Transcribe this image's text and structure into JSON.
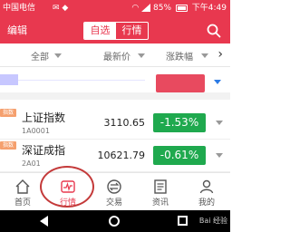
{
  "status_bar": {
    "carrier": "中国电信",
    "battery_percent": "85%",
    "time": "下午4:49"
  },
  "header": {
    "edit_label": "编辑",
    "tabs": [
      {
        "label": "自选",
        "active": true
      },
      {
        "label": "行情",
        "active": false
      }
    ],
    "search_icon": "search-icon"
  },
  "columns": {
    "all": "全部",
    "price": "最新价",
    "change": "涨跌幅"
  },
  "rows": [
    {
      "tag": "指数",
      "name": "上证指数",
      "code": "1A0001",
      "price": "3110.65",
      "change": "-1.53%"
    },
    {
      "tag": "指数",
      "name": "深证成指",
      "code": "2A01",
      "price": "10621.79",
      "change": "-0.61%"
    }
  ],
  "nav": {
    "items": [
      {
        "label": "首页",
        "icon": "home-icon"
      },
      {
        "label": "行情",
        "icon": "market-icon",
        "active": true
      },
      {
        "label": "交易",
        "icon": "trade-icon"
      },
      {
        "label": "资讯",
        "icon": "news-icon"
      },
      {
        "label": "我的",
        "icon": "profile-icon"
      }
    ]
  },
  "watermark": "Bai 经验",
  "colors": {
    "brand": "#e8384f",
    "down": "#1fa94e"
  }
}
